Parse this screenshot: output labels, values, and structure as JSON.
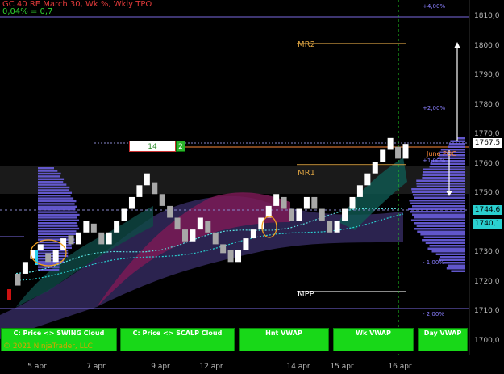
{
  "header": {
    "title": "GC 40 RE March 30, Wk %, Wkly TPO",
    "subtitle": "0,04% = 0,7"
  },
  "price_axis": {
    "ticks": [
      "1810,0",
      "1800,0",
      "1790,0",
      "1780,0",
      "1770,0",
      "1760,0",
      "1750,0",
      "1740,0",
      "1730,0",
      "1720,0",
      "1710,0",
      "1700,0"
    ],
    "last_price": "1767,5",
    "vwap_upper": "1744,6",
    "vwap_lower": "1740,1"
  },
  "date_axis": {
    "ticks": [
      "5 apr",
      "7 apr",
      "9 apr",
      "12 apr",
      "14 apr",
      "15 apr",
      "16 apr"
    ]
  },
  "percent_levels": [
    "+4,00%",
    "+2,00%",
    "+1,00%",
    "- 1,00%",
    "- 2,00%"
  ],
  "levels": {
    "mr2": "MR2",
    "mr1": "MR1",
    "mpp": "MPP"
  },
  "tpo_box": {
    "value": "14",
    "count": "2"
  },
  "poc_label": "June POC",
  "buttons": [
    {
      "label": "C: Price <> SWING Cloud"
    },
    {
      "label": "C: Price <> SCALP Cloud"
    },
    {
      "label": "Hnt VWAP"
    },
    {
      "label": "Wk VWAP"
    },
    {
      "label": "Day VWAP"
    }
  ],
  "copyright": "© 2021 NinjaTrader, LLC",
  "colors": {
    "background": "#000000",
    "up_candle": "#ffffff",
    "down_candle": "#b0b0b0",
    "profile": "#6b5fe0",
    "vwap": "#2ad0d0",
    "cloud_teal": "#0f5a52",
    "cloud_magenta": "#8a1a5a",
    "button": "#18d818",
    "current_time": "#21d021",
    "level_line": "#d09a40"
  },
  "chart_data": {
    "type": "candlestick",
    "title": "GC 40 RE March 30, Wk %, Wkly TPO",
    "ylim": [
      1696,
      1817
    ],
    "x_categories": [
      "5 apr",
      "7 apr",
      "9 apr",
      "12 apr",
      "14 apr",
      "15 apr",
      "16 apr"
    ],
    "candles": [
      {
        "o": 1719,
        "c": 1723,
        "dir": "down"
      },
      {
        "o": 1723,
        "c": 1727,
        "dir": "up"
      },
      {
        "o": 1728,
        "c": 1731,
        "dir": "up"
      },
      {
        "o": 1731,
        "c": 1733,
        "dir": "up"
      },
      {
        "o": 1730,
        "c": 1727,
        "dir": "down"
      },
      {
        "o": 1727,
        "c": 1731,
        "dir": "up"
      },
      {
        "o": 1731,
        "c": 1735,
        "dir": "up"
      },
      {
        "o": 1736,
        "c": 1733,
        "dir": "down"
      },
      {
        "o": 1733,
        "c": 1737,
        "dir": "up"
      },
      {
        "o": 1737,
        "c": 1741,
        "dir": "up"
      },
      {
        "o": 1740,
        "c": 1737,
        "dir": "down"
      },
      {
        "o": 1737,
        "c": 1733,
        "dir": "down"
      },
      {
        "o": 1733,
        "c": 1737,
        "dir": "up"
      },
      {
        "o": 1737,
        "c": 1741,
        "dir": "up"
      },
      {
        "o": 1741,
        "c": 1745,
        "dir": "up"
      },
      {
        "o": 1745,
        "c": 1749,
        "dir": "up"
      },
      {
        "o": 1749,
        "c": 1753,
        "dir": "up"
      },
      {
        "o": 1753,
        "c": 1757,
        "dir": "up"
      },
      {
        "o": 1754,
        "c": 1750,
        "dir": "down"
      },
      {
        "o": 1750,
        "c": 1746,
        "dir": "down"
      },
      {
        "o": 1746,
        "c": 1742,
        "dir": "down"
      },
      {
        "o": 1742,
        "c": 1738,
        "dir": "down"
      },
      {
        "o": 1738,
        "c": 1734,
        "dir": "down"
      },
      {
        "o": 1734,
        "c": 1738,
        "dir": "up"
      },
      {
        "o": 1738,
        "c": 1742,
        "dir": "up"
      },
      {
        "o": 1741,
        "c": 1737,
        "dir": "down"
      },
      {
        "o": 1737,
        "c": 1733,
        "dir": "down"
      },
      {
        "o": 1733,
        "c": 1730,
        "dir": "down"
      },
      {
        "o": 1731,
        "c": 1727,
        "dir": "down"
      },
      {
        "o": 1727,
        "c": 1731,
        "dir": "up"
      },
      {
        "o": 1731,
        "c": 1735,
        "dir": "up"
      },
      {
        "o": 1735,
        "c": 1738,
        "dir": "up"
      },
      {
        "o": 1738,
        "c": 1742,
        "dir": "up"
      },
      {
        "o": 1742,
        "c": 1746,
        "dir": "up"
      },
      {
        "o": 1746,
        "c": 1750,
        "dir": "up"
      },
      {
        "o": 1749,
        "c": 1745,
        "dir": "down"
      },
      {
        "o": 1745,
        "c": 1741,
        "dir": "down"
      },
      {
        "o": 1741,
        "c": 1745,
        "dir": "up"
      },
      {
        "o": 1745,
        "c": 1749,
        "dir": "up"
      },
      {
        "o": 1749,
        "c": 1745,
        "dir": "down"
      },
      {
        "o": 1745,
        "c": 1741,
        "dir": "down"
      },
      {
        "o": 1741,
        "c": 1737,
        "dir": "down"
      },
      {
        "o": 1737,
        "c": 1741,
        "dir": "up"
      },
      {
        "o": 1741,
        "c": 1745,
        "dir": "up"
      },
      {
        "o": 1745,
        "c": 1749,
        "dir": "up"
      },
      {
        "o": 1749,
        "c": 1753,
        "dir": "up"
      },
      {
        "o": 1753,
        "c": 1757,
        "dir": "up"
      },
      {
        "o": 1757,
        "c": 1761,
        "dir": "up"
      },
      {
        "o": 1761,
        "c": 1765,
        "dir": "up"
      },
      {
        "o": 1765,
        "c": 1769,
        "dir": "up"
      },
      {
        "o": 1766,
        "c": 1762,
        "dir": "down"
      },
      {
        "o": 1762,
        "c": 1767,
        "dir": "up"
      }
    ],
    "levels": [
      {
        "name": "MR2",
        "value": 1801
      },
      {
        "name": "MR1",
        "value": 1760
      },
      {
        "name": "MPP",
        "value": 1717
      }
    ],
    "vwap": {
      "upper": 1744.6,
      "lower": 1740.1
    },
    "last_price": 1767.5
  }
}
